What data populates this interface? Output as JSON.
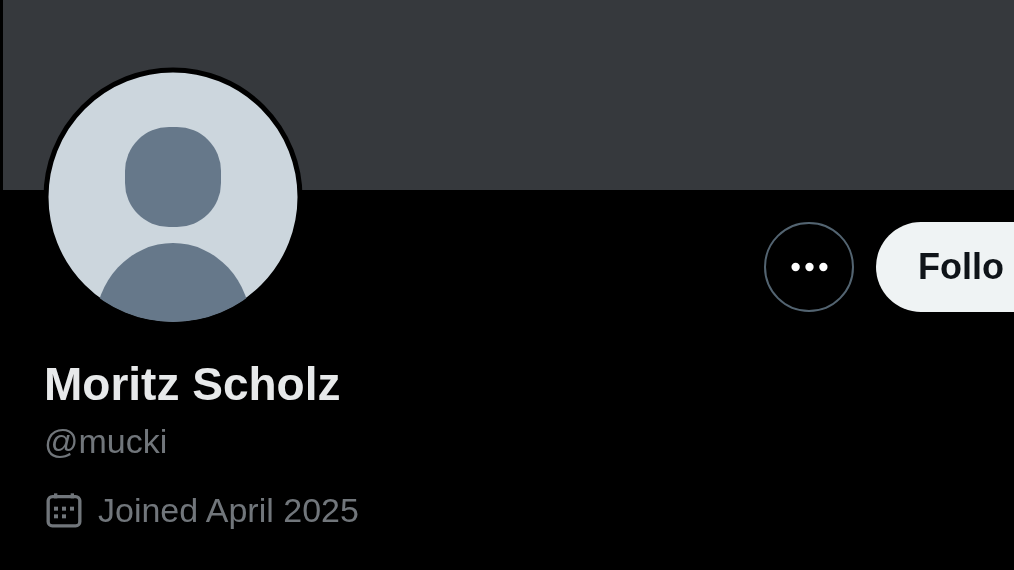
{
  "profile": {
    "name": "Moritz Scholz",
    "handle": "@mucki",
    "joined": "Joined April 2025"
  },
  "actions": [
    {
      "kind": "more"
    },
    {
      "kind": "follow",
      "label": "Follo"
    }
  ]
}
